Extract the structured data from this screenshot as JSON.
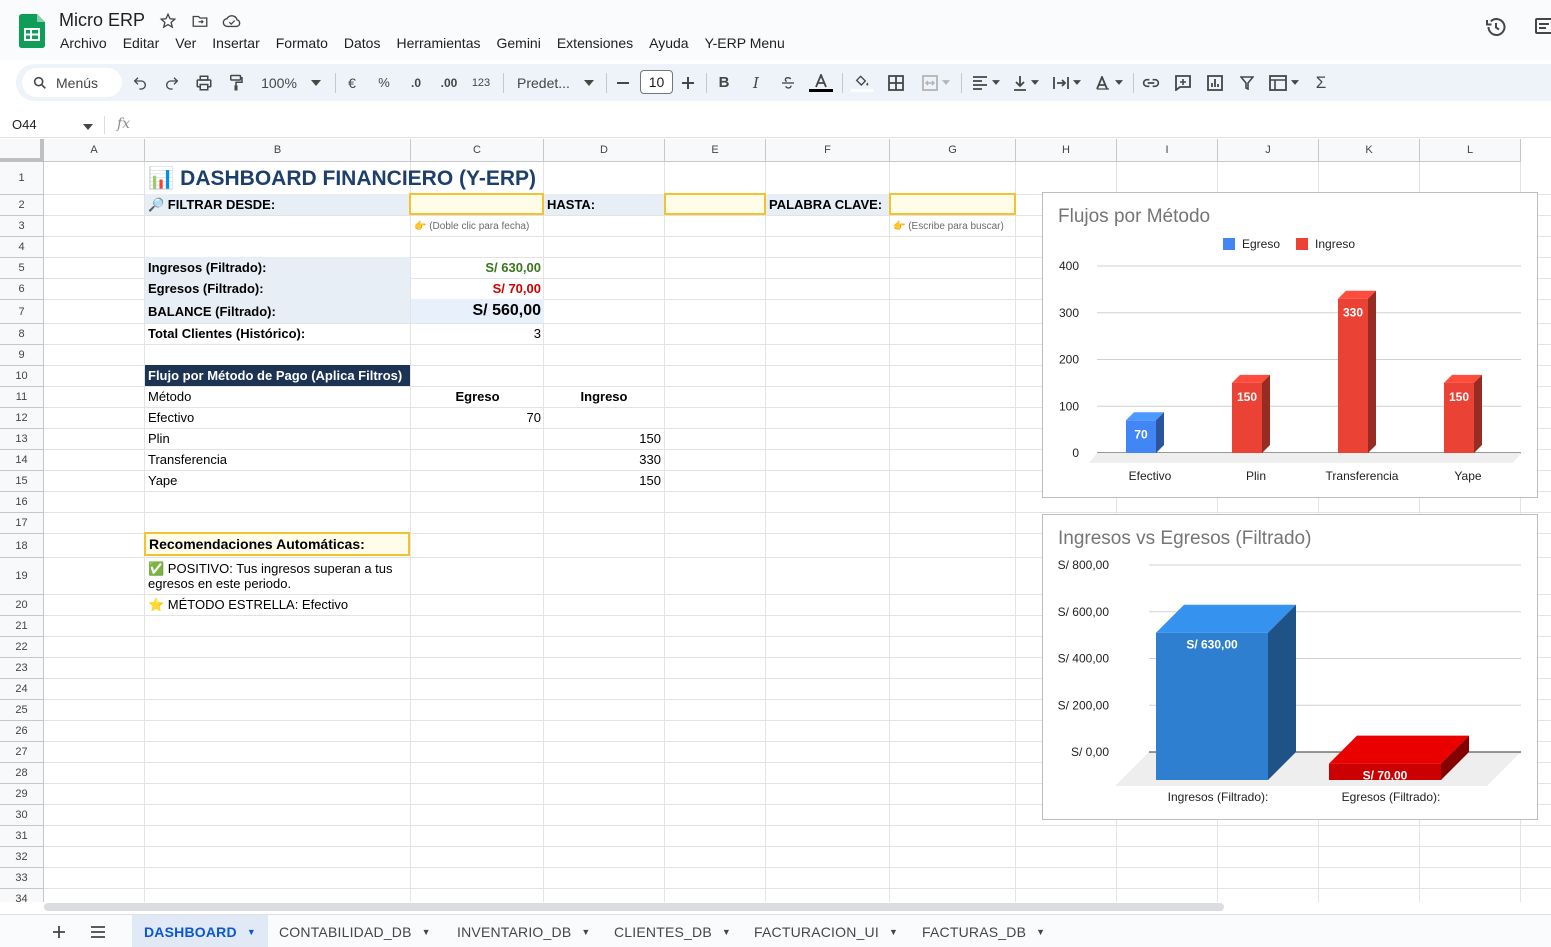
{
  "app": {
    "doc_title": "Micro ERP",
    "menu": [
      "Archivo",
      "Editar",
      "Ver",
      "Insertar",
      "Formato",
      "Datos",
      "Herramientas",
      "Gemini",
      "Extensiones",
      "Ayuda",
      "Y-ERP Menu"
    ]
  },
  "toolbar": {
    "search_label": "Menús",
    "zoom": "100%",
    "currency": "€",
    "percent": "%",
    "dec_decrease": ".0",
    "dec_increase": ".00",
    "number_format": "123",
    "font": "Predet...",
    "font_size": "10"
  },
  "formula_bar": {
    "cell_ref": "O44",
    "fx": "fx",
    "value": ""
  },
  "columns": [
    "A",
    "B",
    "C",
    "D",
    "E",
    "F",
    "G",
    "H",
    "I",
    "J",
    "K",
    "L"
  ],
  "rows": [
    "1",
    "2",
    "3",
    "4",
    "5",
    "6",
    "7",
    "8",
    "9",
    "10",
    "11",
    "12",
    "13",
    "14",
    "15",
    "16",
    "17",
    "18",
    "19",
    "20",
    "21",
    "22",
    "23",
    "24",
    "25",
    "26",
    "27",
    "28",
    "29",
    "30",
    "31",
    "32",
    "33",
    "34"
  ],
  "dashboard": {
    "title_icon": "📊",
    "title": "DASHBOARD FINANCIERO (Y-ERP)",
    "filter_from_label": "🔎 FILTRAR DESDE:",
    "filter_from_value": "",
    "filter_to_label": "HASTA:",
    "filter_to_value": "",
    "keyword_label": "PALABRA CLAVE:",
    "keyword_value": "",
    "date_hint": "👉 (Doble clic para fecha)",
    "keyword_hint": "👉 (Escribe para buscar)",
    "summary": [
      {
        "label": "Ingresos (Filtrado):",
        "value": "S/ 630,00",
        "color": "#38761d"
      },
      {
        "label": "Egresos (Filtrado):",
        "value": "S/ 70,00",
        "color": "#cc0000"
      },
      {
        "label": "BALANCE (Filtrado):",
        "value": "S/ 560,00",
        "color": "#000000"
      },
      {
        "label": "Total Clientes (Histórico):",
        "value": "3",
        "color": "#000000"
      }
    ],
    "method_table": {
      "header": "Flujo por Método de Pago (Aplica Filtros)",
      "columns": [
        "Método",
        "Egreso",
        "Ingreso"
      ],
      "rows": [
        {
          "method": "Efectivo",
          "egreso": "70",
          "ingreso": ""
        },
        {
          "method": "Plin",
          "egreso": "",
          "ingreso": "150"
        },
        {
          "method": "Transferencia",
          "egreso": "",
          "ingreso": "330"
        },
        {
          "method": "Yape",
          "egreso": "",
          "ingreso": "150"
        }
      ]
    },
    "recommendations": {
      "header": "Recomendaciones Automáticas:",
      "items": [
        "✅ POSITIVO: Tus ingresos superan a tus egresos en este periodo.",
        "⭐ MÉTODO ESTRELLA: Efectivo"
      ]
    }
  },
  "chart_data": [
    {
      "type": "bar",
      "title": "Flujos por Método",
      "categories": [
        "Efectivo",
        "Plin",
        "Transferencia",
        "Yape"
      ],
      "series": [
        {
          "name": "Egreso",
          "values": [
            70,
            null,
            null,
            null
          ],
          "color": "#4285f4"
        },
        {
          "name": "Ingreso",
          "values": [
            null,
            150,
            330,
            150
          ],
          "color": "#ea4335"
        }
      ],
      "ylim": [
        0,
        400
      ],
      "yticks": [
        "0",
        "100",
        "200",
        "300",
        "400"
      ],
      "legend": "top",
      "grid": true
    },
    {
      "type": "bar",
      "title": "Ingresos vs Egresos (Filtrado)",
      "categories": [
        "Ingresos (Filtrado):",
        "Egresos (Filtrado):"
      ],
      "values": [
        630,
        70
      ],
      "labels": [
        "S/ 630,00",
        "S/ 70,00"
      ],
      "colors": [
        "#2f7fd0",
        "#cc0000"
      ],
      "ylim": [
        0,
        800
      ],
      "yticks": [
        "S/ 0,00",
        "S/ 200,00",
        "S/ 400,00",
        "S/ 600,00",
        "S/ 800,00"
      ],
      "grid": true
    }
  ],
  "sheet_tabs": [
    {
      "label": "DASHBOARD",
      "active": true
    },
    {
      "label": "CONTABILIDAD_DB",
      "active": false
    },
    {
      "label": "INVENTARIO_DB",
      "active": false
    },
    {
      "label": "CLIENTES_DB",
      "active": false
    },
    {
      "label": "FACTURACION_UI",
      "active": false
    },
    {
      "label": "FACTURAS_DB",
      "active": false
    }
  ]
}
